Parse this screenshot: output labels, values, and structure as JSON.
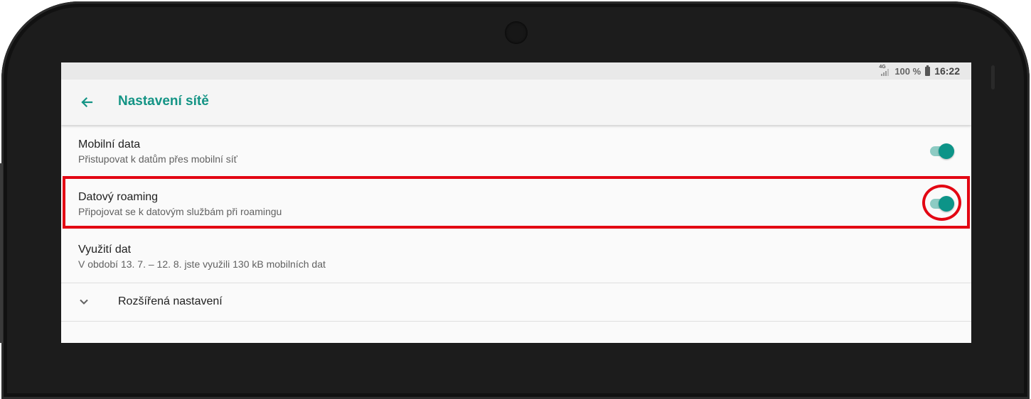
{
  "status_bar": {
    "network_type": "4G",
    "battery_percent": "100 %",
    "time": "16:22"
  },
  "header": {
    "back_icon": "arrow-left-icon",
    "title": "Nastavení sítě"
  },
  "settings": [
    {
      "title": "Mobilní data",
      "subtitle": "Přistupovat k datům přes mobilní síť",
      "toggle_on": true
    },
    {
      "title": "Datový roaming",
      "subtitle": "Připojovat se k datovým službám při roamingu",
      "toggle_on": true,
      "highlighted": true
    },
    {
      "title": "Využití dat",
      "subtitle": "V období 13. 7. – 12. 8. jste využili 130 kB mobilních dat"
    }
  ],
  "advanced": {
    "icon": "chevron-down-icon",
    "label": "Rozšířená nastavení"
  },
  "colors": {
    "accent": "#149485",
    "toggle_thumb": "#0d9488",
    "toggle_track": "#8dcbc3",
    "highlight": "#e30613"
  }
}
